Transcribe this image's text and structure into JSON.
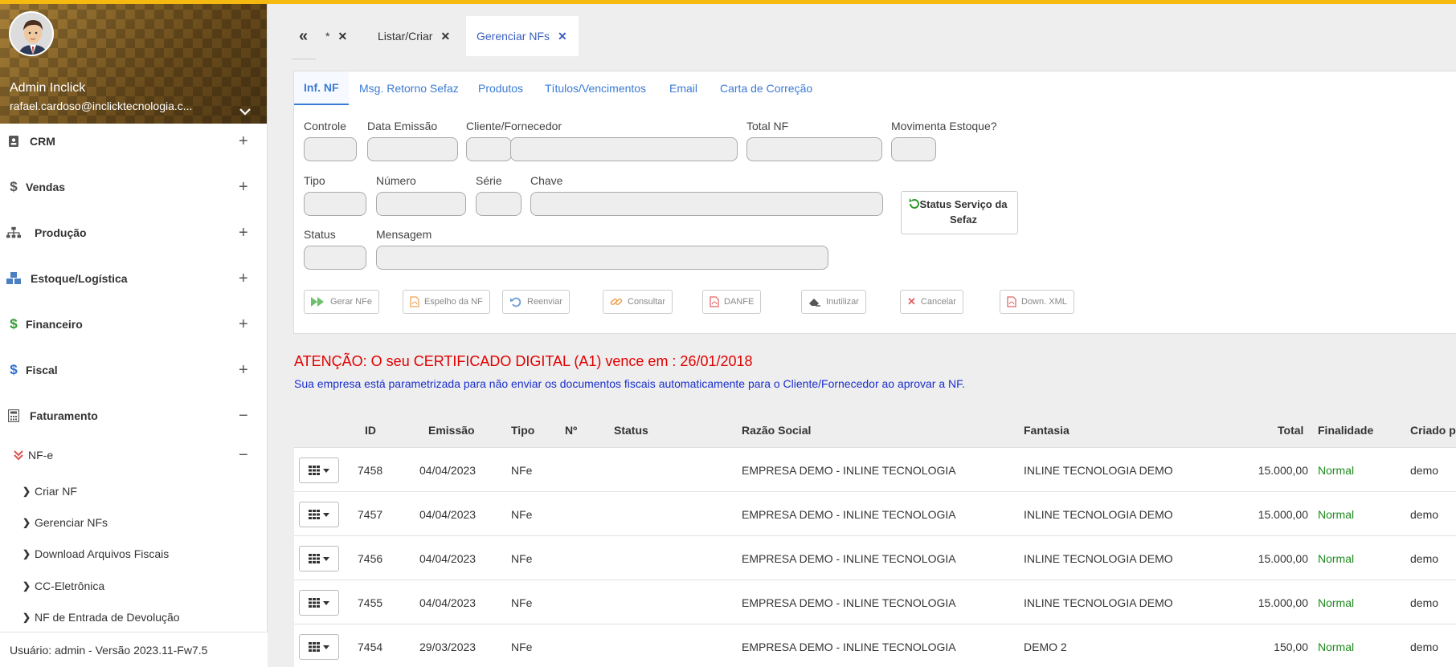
{
  "sidebar": {
    "profile": {
      "name": "Admin Inclick",
      "email": "rafael.cardoso@inclicktecnologia.c..."
    },
    "menu": [
      {
        "label": "CRM",
        "toggle": "+"
      },
      {
        "label": "Vendas",
        "toggle": "+"
      },
      {
        "label": "Produção",
        "toggle": "+"
      },
      {
        "label": "Estoque/Logística",
        "toggle": "+"
      },
      {
        "label": "Financeiro",
        "toggle": "+"
      },
      {
        "label": "Fiscal",
        "toggle": "+"
      },
      {
        "label": "Faturamento",
        "toggle": "−"
      }
    ],
    "nfe": {
      "label": "NF-e",
      "toggle": "−"
    },
    "submenu": [
      {
        "label": "Criar NF"
      },
      {
        "label": "Gerenciar NFs"
      },
      {
        "label": "Download Arquivos Fiscais"
      },
      {
        "label": "CC-Eletrônica"
      },
      {
        "label": "NF de Entrada de Devolução"
      }
    ],
    "footer": "Usuário: admin - Versão 2023.11-Fw7.5"
  },
  "tabs": [
    {
      "label": "«"
    },
    {
      "label": "*"
    },
    {
      "label": "Listar/Criar"
    },
    {
      "label": "Gerenciar NFs"
    }
  ],
  "subtabs": [
    {
      "label": "Inf. NF"
    },
    {
      "label": "Msg. Retorno Sefaz"
    },
    {
      "label": "Produtos"
    },
    {
      "label": "Títulos/Vencimentos"
    },
    {
      "label": "Email"
    },
    {
      "label": "Carta de Correção"
    }
  ],
  "form": {
    "controle": "Controle",
    "data_emissao": "Data Emissão",
    "cliente": "Cliente/Fornecedor",
    "total_nf": "Total NF",
    "movimenta": "Movimenta Estoque?",
    "tipo": "Tipo",
    "numero": "Número",
    "serie": "Série",
    "chave": "Chave",
    "status": "Status",
    "mensagem": "Mensagem",
    "sefaz_button": "Status Serviço da Sefaz"
  },
  "actions": [
    {
      "label": "Gerar NFe"
    },
    {
      "label": "Espelho da NF"
    },
    {
      "label": "Reenviar"
    },
    {
      "label": "Consultar"
    },
    {
      "label": "DANFE"
    },
    {
      "label": "Inutilizar"
    },
    {
      "label": "Cancelar"
    },
    {
      "label": "Down. XML"
    }
  ],
  "warning": "ATENÇÃO: O seu CERTIFICADO DIGITAL (A1) vence em : 26/01/2018",
  "info": "Sua empresa está parametrizada para não enviar os documentos fiscais automaticamente para o Cliente/Fornecedor ao aprovar a NF.",
  "table": {
    "headers": {
      "id": "ID",
      "emissao": "Emissão",
      "tipo": "Tipo",
      "numero": "Nº",
      "status": "Status",
      "razao": "Razão Social",
      "fantasia": "Fantasia",
      "total": "Total",
      "finalidade": "Finalidade",
      "criado": "Criado po"
    },
    "rows": [
      {
        "id": "7458",
        "emissao": "04/04/2023",
        "tipo": "NFe",
        "numero": "",
        "status": "",
        "razao": "EMPRESA DEMO - INLINE TECNOLOGIA",
        "fantasia": "INLINE TECNOLOGIA DEMO",
        "total": "15.000,00",
        "finalidade": "Normal",
        "criado": "demo"
      },
      {
        "id": "7457",
        "emissao": "04/04/2023",
        "tipo": "NFe",
        "numero": "",
        "status": "",
        "razao": "EMPRESA DEMO - INLINE TECNOLOGIA",
        "fantasia": "INLINE TECNOLOGIA DEMO",
        "total": "15.000,00",
        "finalidade": "Normal",
        "criado": "demo"
      },
      {
        "id": "7456",
        "emissao": "04/04/2023",
        "tipo": "NFe",
        "numero": "",
        "status": "",
        "razao": "EMPRESA DEMO - INLINE TECNOLOGIA",
        "fantasia": "INLINE TECNOLOGIA DEMO",
        "total": "15.000,00",
        "finalidade": "Normal",
        "criado": "demo"
      },
      {
        "id": "7455",
        "emissao": "04/04/2023",
        "tipo": "NFe",
        "numero": "",
        "status": "",
        "razao": "EMPRESA DEMO - INLINE TECNOLOGIA",
        "fantasia": "INLINE TECNOLOGIA DEMO",
        "total": "15.000,00",
        "finalidade": "Normal",
        "criado": "demo"
      },
      {
        "id": "7454",
        "emissao": "29/03/2023",
        "tipo": "NFe",
        "numero": "",
        "status": "",
        "razao": "EMPRESA DEMO - INLINE TECNOLOGIA",
        "fantasia": "DEMO 2",
        "total": "150,00",
        "finalidade": "Normal",
        "criado": "demo"
      }
    ]
  },
  "colors": {
    "accent": "#3a7bd5",
    "warning": "#e00000",
    "info": "#1a2fcc",
    "normal": "#1d8a1d",
    "topbar": "#f5b90f"
  }
}
